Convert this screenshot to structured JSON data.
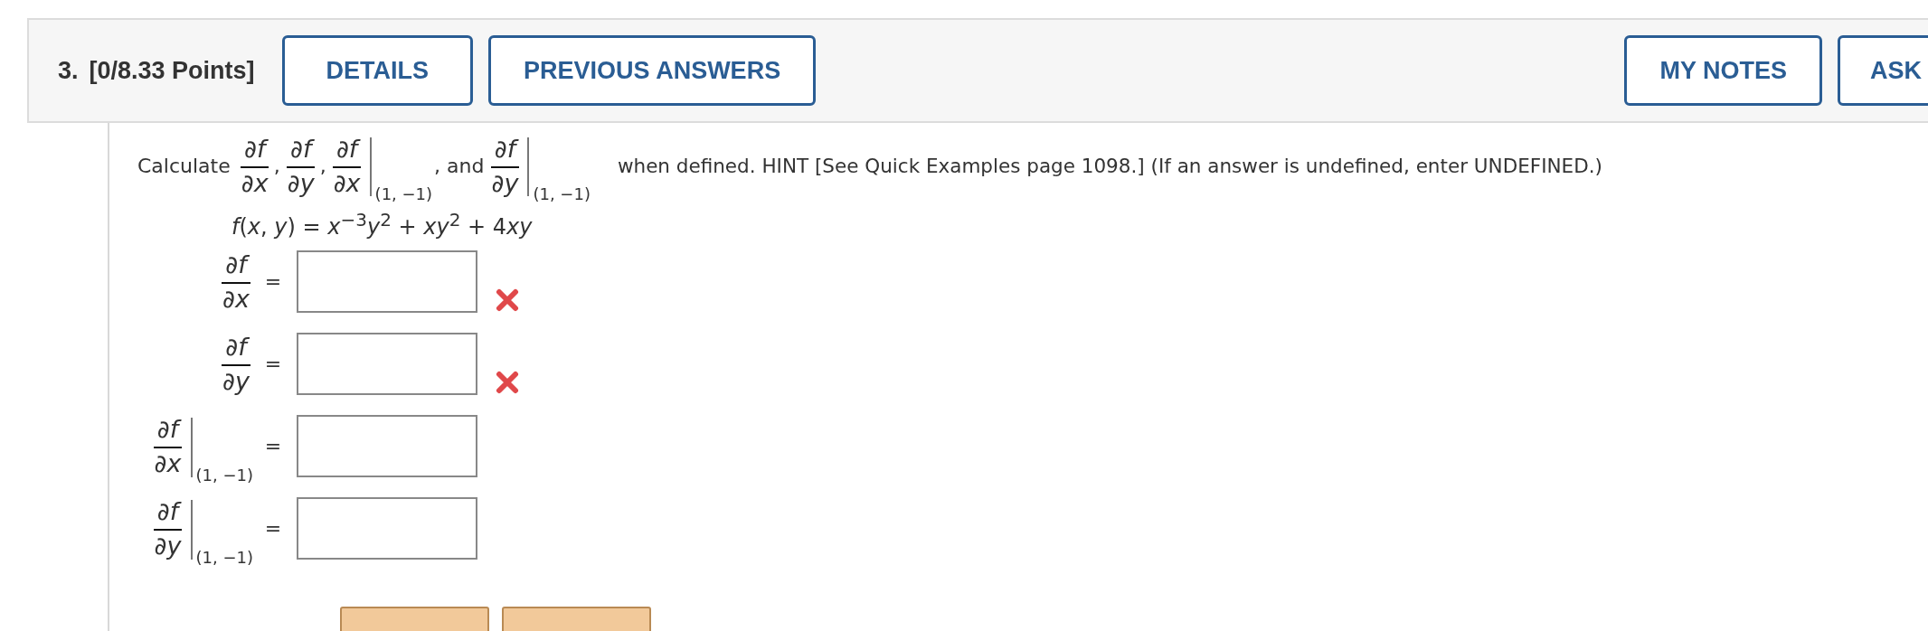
{
  "header": {
    "number": "3.",
    "points": "[0/8.33 Points]",
    "left_buttons": [
      {
        "label": "DETAILS"
      },
      {
        "label": "PREVIOUS ANSWERS"
      }
    ],
    "right_buttons": [
      {
        "label": "MY NOTES"
      },
      {
        "label": "ASK"
      }
    ]
  },
  "prompt": {
    "lead": "Calculate",
    "terms": [
      {
        "num": "∂f",
        "den": "∂x",
        "sep": ","
      },
      {
        "num": "∂f",
        "den": "∂y",
        "sep": ","
      },
      {
        "num": "∂f",
        "den": "∂x",
        "at": "(1, −1)",
        "sep": ", and"
      },
      {
        "num": "∂f",
        "den": "∂y",
        "at": "(1, −1)"
      }
    ],
    "tail": "when defined. HINT [See Quick Examples page 1098.] (If an answer is undefined, enter UNDEFINED.)"
  },
  "function": [
    "*f*(*x*, *y*) = *x*$^{−3}$*y*$^{2}$ + *xy*$^{2}$ + 4",
    "*xy*"
  ],
  "answers": [
    {
      "num": "∂f",
      "den": "∂x",
      "equals": "=",
      "incorrect": true
    },
    {
      "num": "∂f",
      "den": "∂y",
      "equals": "=",
      "incorrect": true
    },
    {
      "num": "∂f",
      "den": "∂x",
      "at": "(1, −1)",
      "equals": "=",
      "incorrect": false
    },
    {
      "num": "∂f",
      "den": "∂y",
      "at": "(1, −1)",
      "equals": "=",
      "incorrect": false
    }
  ],
  "bottom_buttons": [
    {
      "kind": "action"
    },
    {
      "kind": "action"
    }
  ]
}
